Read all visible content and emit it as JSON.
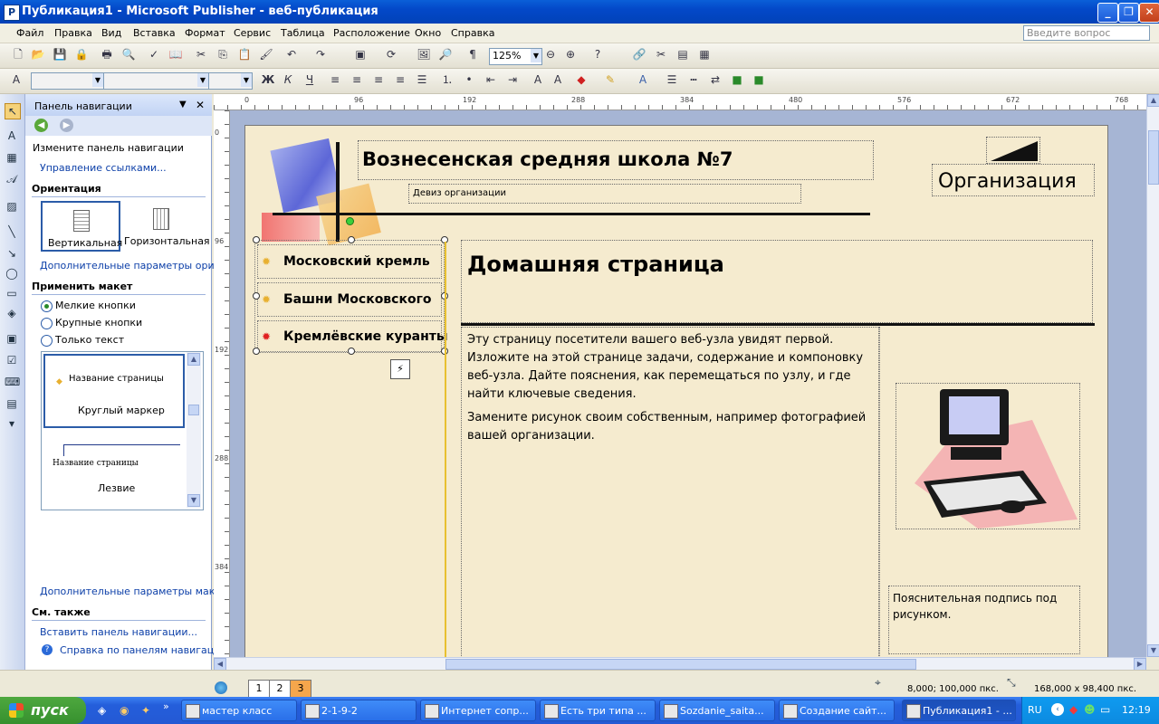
{
  "window": {
    "title": "Публикация1 - Microsoft Publisher - веб-публикация",
    "app_icon": "P"
  },
  "menu": {
    "items": [
      "Файл",
      "Правка",
      "Вид",
      "Вставка",
      "Формат",
      "Сервис",
      "Таблица",
      "Расположение",
      "Окно",
      "Справка"
    ],
    "help_placeholder": "Введите вопрос"
  },
  "toolbar": {
    "zoom": "125%"
  },
  "taskpane": {
    "title": "Панель навигации",
    "sec_change": "Измените панель навигации",
    "link_manage": "Управление ссылками...",
    "sec_orient": "Ориентация",
    "orient_vertical": "Вертикальная",
    "orient_horizontal": "Горизонтальная",
    "link_orient_more": "Дополнительные параметры ориент",
    "sec_layout": "Применить макет",
    "radio_small": "Мелкие кнопки",
    "radio_large": "Крупные кнопки",
    "radio_text": "Только текст",
    "style1_item": "Название страницы",
    "style1_name": "Круглый маркер",
    "style2_item": "Название страницы",
    "style2_name": "Лезвие",
    "link_layout_more": "Дополнительные параметры макета",
    "sec_see_also": "См. также",
    "link_insert": "Вставить панель навигации...",
    "link_help": "Справка по панелям навигации"
  },
  "ruler": {
    "top_ticks": [
      "0",
      "96",
      "192",
      "288",
      "384",
      "480",
      "576",
      "672",
      "768"
    ],
    "left_ticks": [
      "0",
      "96",
      "192",
      "288",
      "384"
    ],
    "corner": "L"
  },
  "page": {
    "org_title": "Вознесенская средняя школа №7",
    "motto": "Девиз организации",
    "org_logo": "Организация",
    "nav_items": [
      "Московский кремль",
      "Башни Московского",
      "Кремлёвские куранты"
    ],
    "heading": "Домашняя страница",
    "body_p1": "Эту страницу посетители вашего веб-узла увидят первой. Изложите на этой странице задачи, содержание и компоновку веб-узла. Дайте пояснения, как перемещаться по узлу, и где найти ключевые сведения.",
    "body_p2": "Замените рисунок своим собственным, например фотографией вашей организации.",
    "caption": "Пояснительная подпись под рисунком."
  },
  "status": {
    "pages": [
      "1",
      "2",
      "3"
    ],
    "position": "8,000; 100,000 пкс.",
    "size": "168,000 x  98,400 пкс."
  },
  "taskbar": {
    "start": "пуск",
    "tasks": [
      "мастер класс",
      "2-1-9-2",
      "Интернет сопр...",
      "Есть три типа ...",
      "Sozdanie_saita...",
      "Создание сайт...",
      "Публикация1 - ..."
    ],
    "lang": "RU",
    "clock": "12:19"
  },
  "colors": {
    "title_blue": "#0348c8",
    "page_bg": "#f5ebcf",
    "nav_bullet_active": "#e02020",
    "nav_bullet": "#e8b030",
    "start_green": "#3a962f"
  }
}
